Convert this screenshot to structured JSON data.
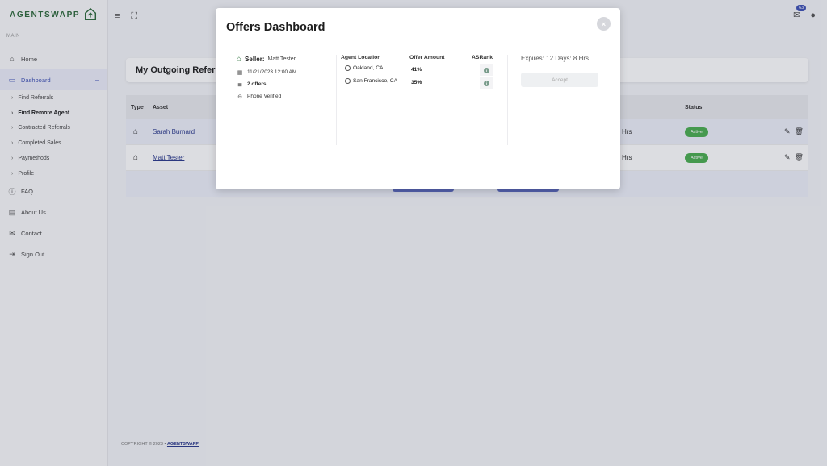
{
  "app": {
    "brand": "AGENTSWAPP",
    "notification_count": "63"
  },
  "sidebar": {
    "section": "MAIN",
    "home": "Home",
    "dashboard": "Dashboard",
    "sub_items": [
      "Find Referrals",
      "Find Remote Agent",
      "Contracted Referrals",
      "Completed Sales",
      "Paymethods",
      "Profile"
    ],
    "faq": "FAQ",
    "about": "About Us",
    "contact": "Contact",
    "signout": "Sign Out"
  },
  "page": {
    "title": "My Outgoing Referrals",
    "headers": {
      "type": "Type",
      "asset": "Asset",
      "status": "Status"
    },
    "rows": [
      {
        "asset": "Sarah Burnard",
        "time": "Hrs",
        "status": "Active"
      },
      {
        "asset": "Matt Tester",
        "time": "Hrs",
        "status": "Active"
      }
    ]
  },
  "footer": {
    "copyright": "COPYRIGHT © 2023",
    "link": "AGENTSWAPP"
  },
  "modal": {
    "title": "Offers Dashboard",
    "seller_label": "Seller:",
    "seller_name": "Matt Tester",
    "date": "11/21/2023 12:00 AM",
    "offers": "2 offers",
    "verified": "Phone Verified",
    "col_location": "Agent Location",
    "col_amount": "Offer Amount",
    "col_rank": "ASRank",
    "offer_rows": [
      {
        "location": "Oakland, CA",
        "amount": "41%"
      },
      {
        "location": "San Francisco, CA",
        "amount": "35%"
      }
    ],
    "expires": "Expires: 12 Days: 8 Hrs",
    "accept": "Accept"
  }
}
